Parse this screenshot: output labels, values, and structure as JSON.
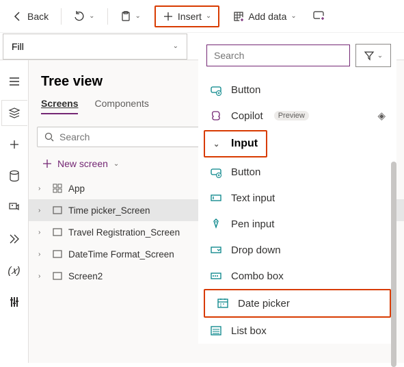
{
  "toolbar": {
    "back": "Back",
    "insert": "Insert",
    "add_data": "Add data"
  },
  "formula": {
    "property": "Fill"
  },
  "tree": {
    "title": "Tree view",
    "tab_screens": "Screens",
    "tab_components": "Components",
    "search_placeholder": "Search",
    "new_screen": "New screen",
    "items": [
      {
        "label": "App",
        "icon": "app"
      },
      {
        "label": "Time picker_Screen",
        "icon": "screen",
        "selected": true
      },
      {
        "label": "Travel Registration_Screen",
        "icon": "screen"
      },
      {
        "label": "DateTime Format_Screen",
        "icon": "screen"
      },
      {
        "label": "Screen2",
        "icon": "screen"
      }
    ]
  },
  "insert_panel": {
    "search_placeholder": "Search",
    "top_items": [
      {
        "label": "Button",
        "icon": "button"
      },
      {
        "label": "Copilot",
        "icon": "copilot",
        "badge": "Preview",
        "premium": true
      }
    ],
    "category": "Input",
    "input_items": [
      {
        "label": "Button",
        "icon": "button"
      },
      {
        "label": "Text input",
        "icon": "textinput"
      },
      {
        "label": "Pen input",
        "icon": "pen"
      },
      {
        "label": "Drop down",
        "icon": "dropdown"
      },
      {
        "label": "Combo box",
        "icon": "combo"
      },
      {
        "label": "Date picker",
        "icon": "date",
        "highlighted": true
      },
      {
        "label": "List box",
        "icon": "list"
      }
    ]
  }
}
